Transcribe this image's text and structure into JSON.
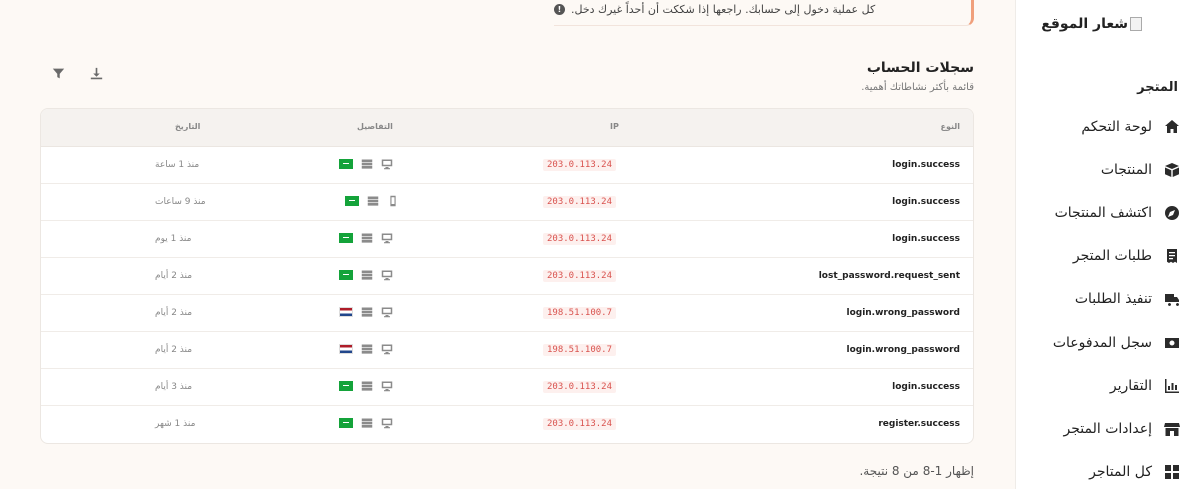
{
  "alert": {
    "text": "كل عملية دخول إلى حسابك. راجعها إذا شككت أن أحداً غيرك دخل."
  },
  "sidebar": {
    "logo_text": "شعار الموقع",
    "section_label": "المتجر",
    "items": [
      {
        "label": "لوحة التحكم",
        "icon": "home-icon"
      },
      {
        "label": "المنتجات",
        "icon": "box-icon"
      },
      {
        "label": "اكتشف المنتجات",
        "icon": "compass-icon"
      },
      {
        "label": "طلبات المتجر",
        "icon": "receipt-icon"
      },
      {
        "label": "تنفيذ الطلبات",
        "icon": "truck-icon"
      },
      {
        "label": "سجل المدفوعات",
        "icon": "money-icon"
      },
      {
        "label": "التقارير",
        "icon": "chart-icon"
      },
      {
        "label": "إعدادات المتجر",
        "icon": "store-icon"
      },
      {
        "label": "كل المتاجر",
        "icon": "grid-icon"
      }
    ]
  },
  "header": {
    "title": "سجلات الحساب",
    "subtitle": "قائمة بأكثر نشاطاتك أهمية."
  },
  "table": {
    "columns": {
      "type": "النوع",
      "ip": "IP",
      "details": "التفاصيل",
      "date": "التاريخ"
    },
    "rows": [
      {
        "type": "login.success",
        "ip": "203.0.113.24",
        "flag": "sa",
        "device": "desktop",
        "date": "منذ 1 ساعة"
      },
      {
        "type": "login.success",
        "ip": "203.0.113.24",
        "flag": "sa",
        "device": "mobile",
        "date": "منذ 9 ساعات"
      },
      {
        "type": "login.success",
        "ip": "203.0.113.24",
        "flag": "sa",
        "device": "desktop",
        "date": "منذ 1 يوم"
      },
      {
        "type": "lost_password.request_sent",
        "ip": "203.0.113.24",
        "flag": "sa",
        "device": "desktop",
        "date": "منذ 2 أيام"
      },
      {
        "type": "login.wrong_password",
        "ip": "198.51.100.7",
        "flag": "nl",
        "device": "desktop",
        "date": "منذ 2 أيام"
      },
      {
        "type": "login.wrong_password",
        "ip": "198.51.100.7",
        "flag": "nl",
        "device": "desktop",
        "date": "منذ 2 أيام"
      },
      {
        "type": "login.success",
        "ip": "203.0.113.24",
        "flag": "sa",
        "device": "desktop",
        "date": "منذ 3 أيام"
      },
      {
        "type": "register.success",
        "ip": "203.0.113.24",
        "flag": "sa",
        "device": "desktop",
        "date": "منذ 1 شهر"
      }
    ]
  },
  "footer": {
    "results_text": "إظهار 1-8 من 8 نتيجة."
  }
}
